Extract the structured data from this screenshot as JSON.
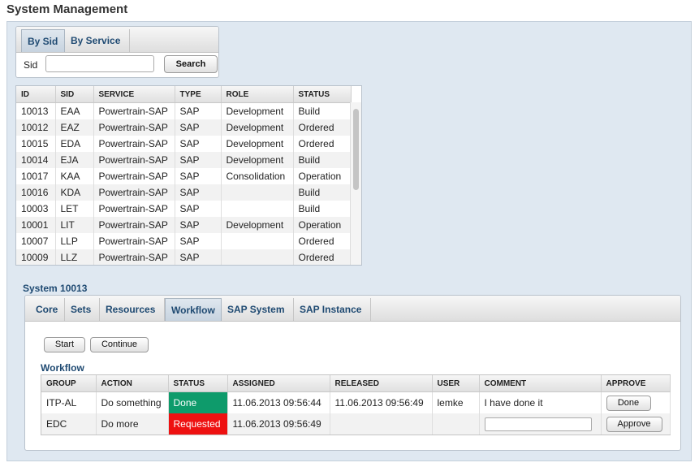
{
  "page_title": "System Management",
  "search": {
    "tabs": [
      {
        "label": "By Sid"
      },
      {
        "label": "By Service"
      }
    ],
    "sid_label": "Sid",
    "sid_value": "",
    "search_button": "Search"
  },
  "systems": {
    "columns": [
      "ID",
      "SID",
      "SERVICE",
      "TYPE",
      "ROLE",
      "STATUS"
    ],
    "rows": [
      [
        "10013",
        "EAA",
        "Powertrain-SAP",
        "SAP",
        "Development",
        "Build"
      ],
      [
        "10012",
        "EAZ",
        "Powertrain-SAP",
        "SAP",
        "Development",
        "Ordered"
      ],
      [
        "10015",
        "EDA",
        "Powertrain-SAP",
        "SAP",
        "Development",
        "Ordered"
      ],
      [
        "10014",
        "EJA",
        "Powertrain-SAP",
        "SAP",
        "Development",
        "Build"
      ],
      [
        "10017",
        "KAA",
        "Powertrain-SAP",
        "SAP",
        "Consolidation",
        "Operation"
      ],
      [
        "10016",
        "KDA",
        "Powertrain-SAP",
        "SAP",
        "",
        "Build"
      ],
      [
        "10003",
        "LET",
        "Powertrain-SAP",
        "SAP",
        "",
        "Build"
      ],
      [
        "10001",
        "LIT",
        "Powertrain-SAP",
        "SAP",
        "Development",
        "Operation"
      ],
      [
        "10007",
        "LLP",
        "Powertrain-SAP",
        "SAP",
        "",
        "Ordered"
      ],
      [
        "10009",
        "LLZ",
        "Powertrain-SAP",
        "SAP",
        "",
        "Ordered"
      ]
    ]
  },
  "detail": {
    "title": "System 10013",
    "tabs": [
      {
        "label": "Core"
      },
      {
        "label": "Sets"
      },
      {
        "label": "Resources"
      },
      {
        "label": "Workflow"
      },
      {
        "label": "SAP System"
      },
      {
        "label": "SAP Instance"
      }
    ],
    "active_tab": "Workflow",
    "start_button": "Start",
    "continue_button": "Continue",
    "workflow_title": "Workflow",
    "workflow_columns": [
      "GROUP",
      "ACTION",
      "STATUS",
      "ASSIGNED",
      "RELEASED",
      "USER",
      "COMMENT",
      "APPROVE"
    ],
    "workflow_rows": [
      {
        "group": "ITP-AL",
        "action": "Do something",
        "status": "Done",
        "status_color": "#0e9b6b",
        "assigned": "11.06.2013 09:56:44",
        "released": "11.06.2013 09:56:49",
        "user": "lemke",
        "comment": "I have done it",
        "approve": "Done"
      },
      {
        "group": "EDC",
        "action": "Do more",
        "status": "Requested",
        "status_color": "#ee1111",
        "assigned": "11.06.2013 09:56:49",
        "released": "",
        "user": "",
        "comment": "",
        "approve": "Approve"
      }
    ]
  }
}
